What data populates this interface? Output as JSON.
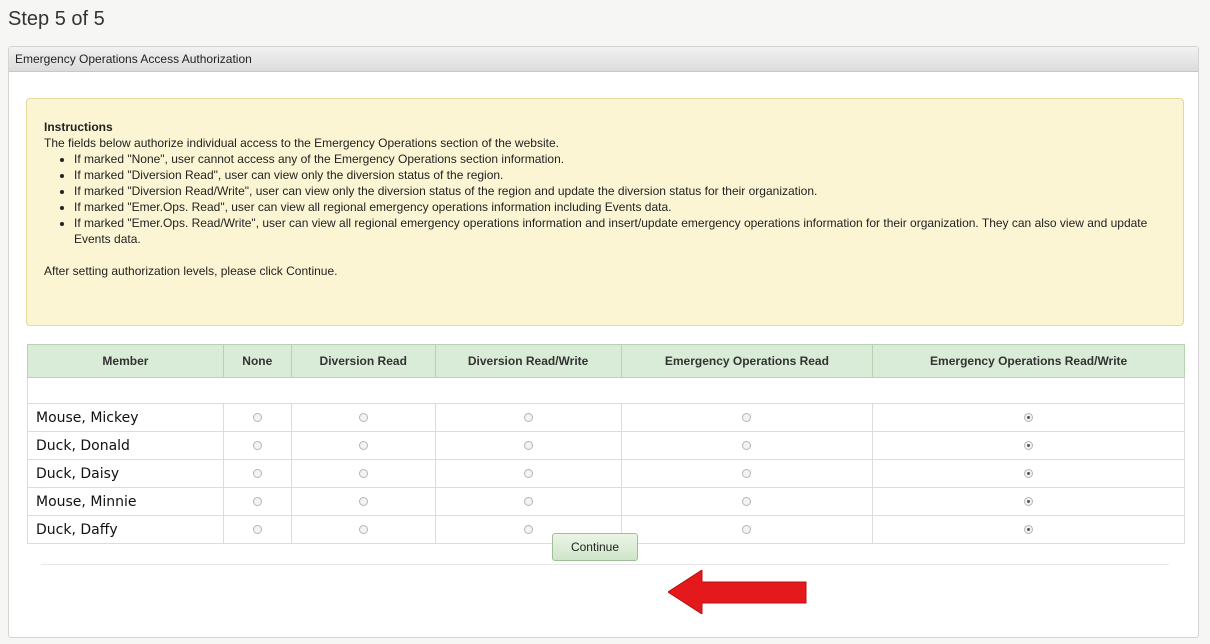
{
  "step_title": "Step 5 of 5",
  "panel_title": "Emergency Operations Access Authorization",
  "instructions": {
    "title": "Instructions",
    "intro": "The fields below authorize individual access to the Emergency Operations section of the website.",
    "bullets": [
      "If marked \"None\", user cannot access any of the Emergency Operations section information.",
      "If marked \"Diversion Read\", user can view only the diversion status of the region.",
      "If marked \"Diversion Read/Write\", user can view only the diversion status of the region and update the diversion status for their organization.",
      "If marked \"Emer.Ops. Read\", user can view all regional emergency operations information including Events data.",
      "If marked \"Emer.Ops. Read/Write\", user can view all regional emergency operations information and insert/update emergency operations information for their organization. They can also view and update Events data."
    ],
    "footer": "After setting authorization levels, please click Continue."
  },
  "table": {
    "headers": [
      "Member",
      "None",
      "Diversion Read",
      "Diversion Read/Write",
      "Emergency Operations Read",
      "Emergency Operations Read/Write"
    ],
    "rows": [
      {
        "member": "Mouse, Mickey",
        "selected": "Emergency Operations Read/Write"
      },
      {
        "member": "Duck, Donald",
        "selected": "Emergency Operations Read/Write"
      },
      {
        "member": "Duck, Daisy",
        "selected": "Emergency Operations Read/Write"
      },
      {
        "member": "Mouse, Minnie",
        "selected": "Emergency Operations Read/Write"
      },
      {
        "member": "Duck, Daffy",
        "selected": "Emergency Operations Read/Write"
      }
    ]
  },
  "continue_label": "Continue",
  "colors": {
    "instructions_bg": "#fcf5d3",
    "table_header_bg": "#d9ecd7",
    "arrow": "#e3191b"
  }
}
